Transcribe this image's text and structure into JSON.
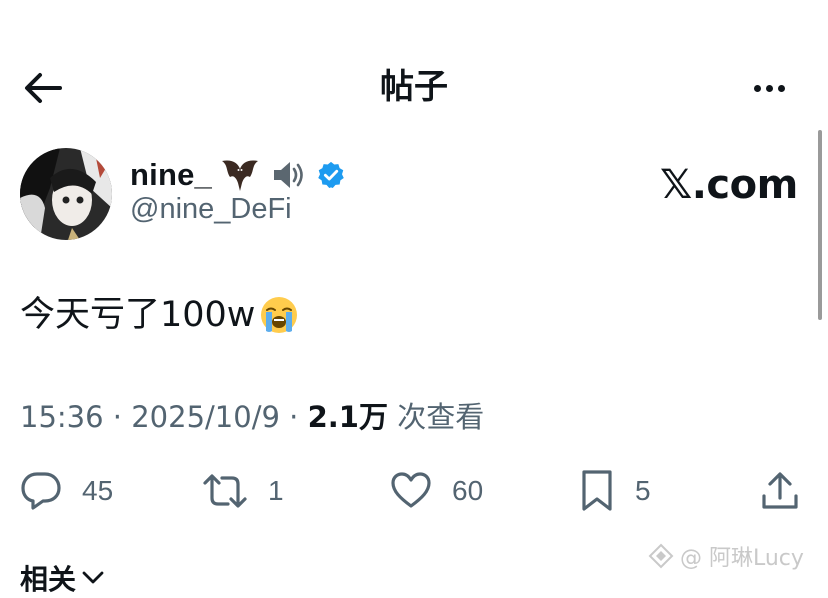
{
  "header": {
    "title": "帖子",
    "back_icon": "arrow-left-icon",
    "more_icon": "more-horizontal-icon"
  },
  "author": {
    "display_name": "nine_",
    "name_emojis": [
      "bat-emoji",
      "speaker-emoji"
    ],
    "verified_icon": "verified-badge-icon",
    "handle": "@nine_DeFi"
  },
  "source": {
    "label": "𝕏.com"
  },
  "post": {
    "text": "今天亏了100w",
    "emoji": "loudly-crying-face-emoji"
  },
  "meta": {
    "time": "15:36",
    "sep1": "·",
    "date": "2025/10/9",
    "sep2": "·",
    "views_count": "2.1万",
    "views_label": "次查看"
  },
  "actions": {
    "reply": {
      "icon": "reply-icon",
      "count": "45"
    },
    "retweet": {
      "icon": "retweet-icon",
      "count": "1"
    },
    "like": {
      "icon": "heart-icon",
      "count": "60"
    },
    "bookmark": {
      "icon": "bookmark-icon",
      "count": "5"
    },
    "share": {
      "icon": "share-icon"
    }
  },
  "related": {
    "label": "相关"
  },
  "watermark": {
    "text": "@ 阿琳Lucy"
  },
  "colors": {
    "text": "#0f1419",
    "muted": "#536471",
    "verified": "#1d9bf0",
    "background": "#ffffff"
  }
}
